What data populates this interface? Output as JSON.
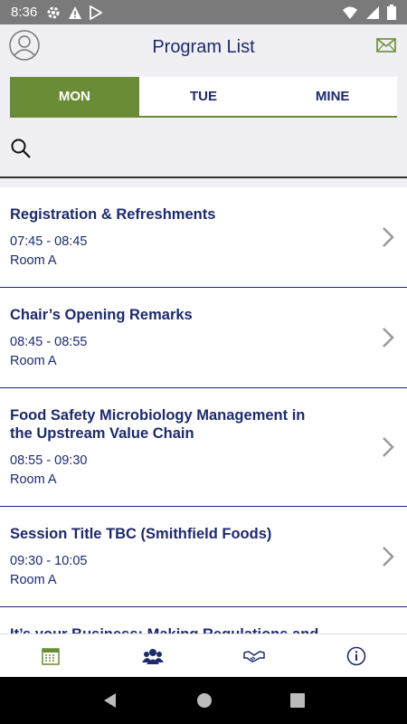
{
  "status_bar": {
    "time": "8:36"
  },
  "header": {
    "title": "Program List",
    "avatar_icon": "user-avatar-icon",
    "mail_icon": "mail-icon"
  },
  "tabs": [
    {
      "label": "MON",
      "active": true
    },
    {
      "label": "TUE",
      "active": false
    },
    {
      "label": "MINE",
      "active": false
    }
  ],
  "search": {
    "icon": "search-icon"
  },
  "sessions": [
    {
      "title": "Registration & Refreshments",
      "time": "07:45 - 08:45",
      "room": "Room A"
    },
    {
      "title": "Chair’s Opening Remarks",
      "time": "08:45 - 08:55",
      "room": "Room A"
    },
    {
      "title": "Food Safety Microbiology Management in the Upstream Value Chain",
      "time": "08:55 - 09:30",
      "room": "Room A"
    },
    {
      "title": "Session Title TBC (Smithfield Foods)",
      "time": "09:30 - 10:05",
      "room": "Room A"
    },
    {
      "title": "It’s your Business: Making Regulations and",
      "time": "",
      "room": ""
    }
  ],
  "bottom_nav": [
    "calendar-icon",
    "people-icon",
    "handshake-icon",
    "info-icon"
  ],
  "colors": {
    "accent": "#6a8c36",
    "primary_text": "#1d2a6b",
    "background": "#efeff4"
  }
}
